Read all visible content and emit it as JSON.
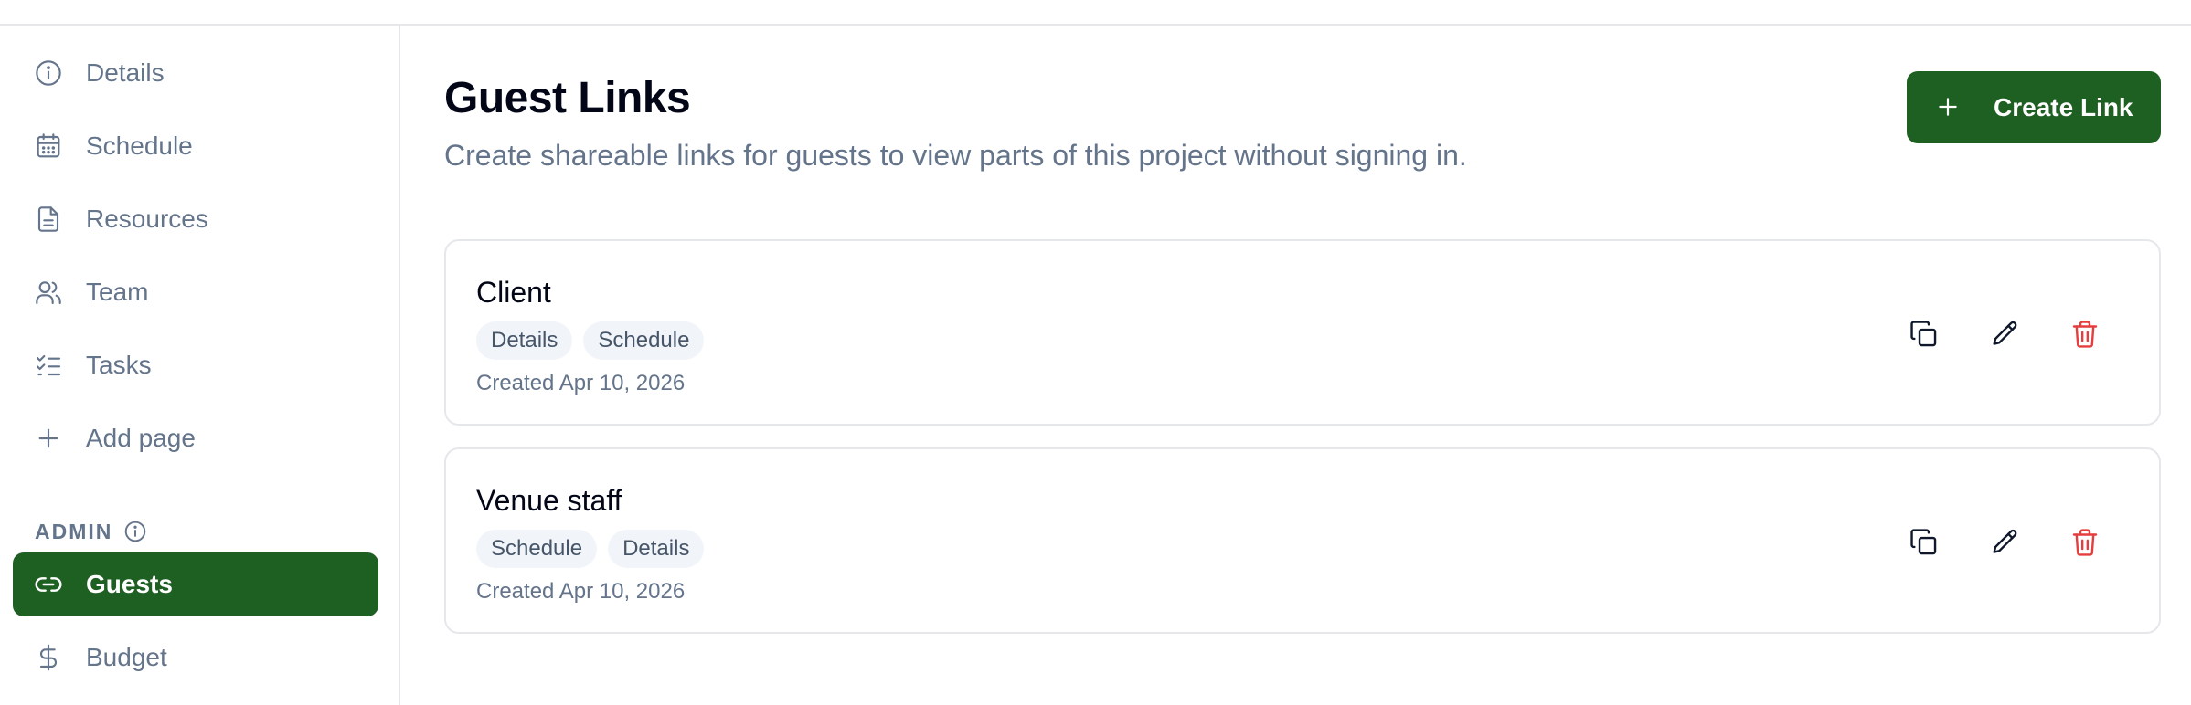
{
  "sidebar": {
    "items": [
      {
        "label": "Details",
        "icon": "info-circle-icon"
      },
      {
        "label": "Schedule",
        "icon": "calendar-icon"
      },
      {
        "label": "Resources",
        "icon": "document-icon"
      },
      {
        "label": "Team",
        "icon": "users-icon"
      },
      {
        "label": "Tasks",
        "icon": "task-list-icon"
      },
      {
        "label": "Add page",
        "icon": "plus-icon"
      }
    ],
    "admin_label": "ADMIN",
    "admin_items": [
      {
        "label": "Guests",
        "icon": "link-icon",
        "active": true
      },
      {
        "label": "Budget",
        "icon": "dollar-icon"
      }
    ]
  },
  "main": {
    "title": "Guest Links",
    "subtitle": "Create shareable links for guests to view parts of this project without signing in.",
    "create_button_label": "Create Link",
    "links": [
      {
        "name": "Client",
        "tags": [
          "Details",
          "Schedule"
        ],
        "created": "Created Apr 10, 2026"
      },
      {
        "name": "Venue staff",
        "tags": [
          "Schedule",
          "Details"
        ],
        "created": "Created Apr 10, 2026"
      }
    ]
  },
  "colors": {
    "accent": "#1e5f22",
    "muted_text": "#64748b",
    "danger": "#e53e3e",
    "border": "#e5e7eb",
    "tag_bg": "#f1f5f9"
  }
}
